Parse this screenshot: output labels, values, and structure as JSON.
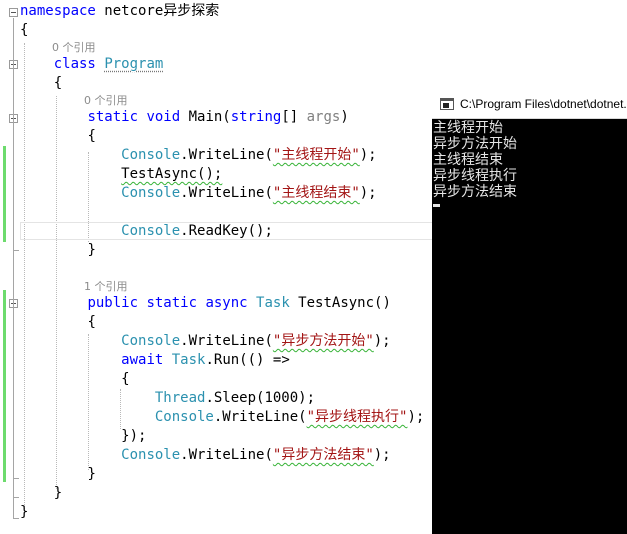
{
  "editor": {
    "lines": {
      "l1_kw": "namespace",
      "l1_name": " netcore异步探索",
      "l2": "{",
      "l3_kw": "class",
      "l3_name": "Program",
      "l4": "{",
      "l5_kw": "static void",
      "l5_name": " Main(",
      "l5_type": "string",
      "l5_rest": "[] ",
      "l5_param": "args",
      "l5_end": ")",
      "l6": "{",
      "l7_type": "Console",
      "l7_mid": ".WriteLine(",
      "l7_str": "\"主线程开始\"",
      "l7_end": ");",
      "l8": "TestAsync();",
      "l9_type": "Console",
      "l9_mid": ".WriteLine(",
      "l9_str": "\"主线程结束\"",
      "l9_end": ");",
      "l10_type": "Console",
      "l10_rest": ".ReadKey();",
      "l11": "}",
      "l12_kw": "public static async",
      "l12_type": "Task",
      "l12_rest": " TestAsync()",
      "l13": "{",
      "l14_type": "Console",
      "l14_mid": ".WriteLine(",
      "l14_str": "\"异步方法开始\"",
      "l14_end": ");",
      "l15_kw": "await",
      "l15_type": "Task",
      "l15_rest": ".Run(() =>",
      "l16": "{",
      "l17_type": "Thread",
      "l17_rest": ".Sleep(1000);",
      "l18_type": "Console",
      "l18_mid": ".WriteLine(",
      "l18_str": "\"异步线程执行\"",
      "l18_end": ");",
      "l19": "});",
      "l20_type": "Console",
      "l20_mid": ".WriteLine(",
      "l20_str": "\"异步方法结束\"",
      "l20_end": ");",
      "l21": "}",
      "l22": "}",
      "l23": "}"
    },
    "codelens": {
      "program_refs": "0 个引用",
      "main_refs": "0 个引用",
      "testasync_refs": "1 个引用"
    },
    "colors": {
      "keyword": "#0000ff",
      "type": "#2b91af",
      "string": "#a31515",
      "change_bar": "#6ddb6d"
    }
  },
  "console": {
    "title": "C:\\Program Files\\dotnet\\dotnet.exe",
    "output": [
      "主线程开始",
      "异步方法开始",
      "主线程结束",
      "异步线程执行",
      "异步方法结束"
    ],
    "background": "#000000",
    "foreground": "#e6e6e6"
  }
}
